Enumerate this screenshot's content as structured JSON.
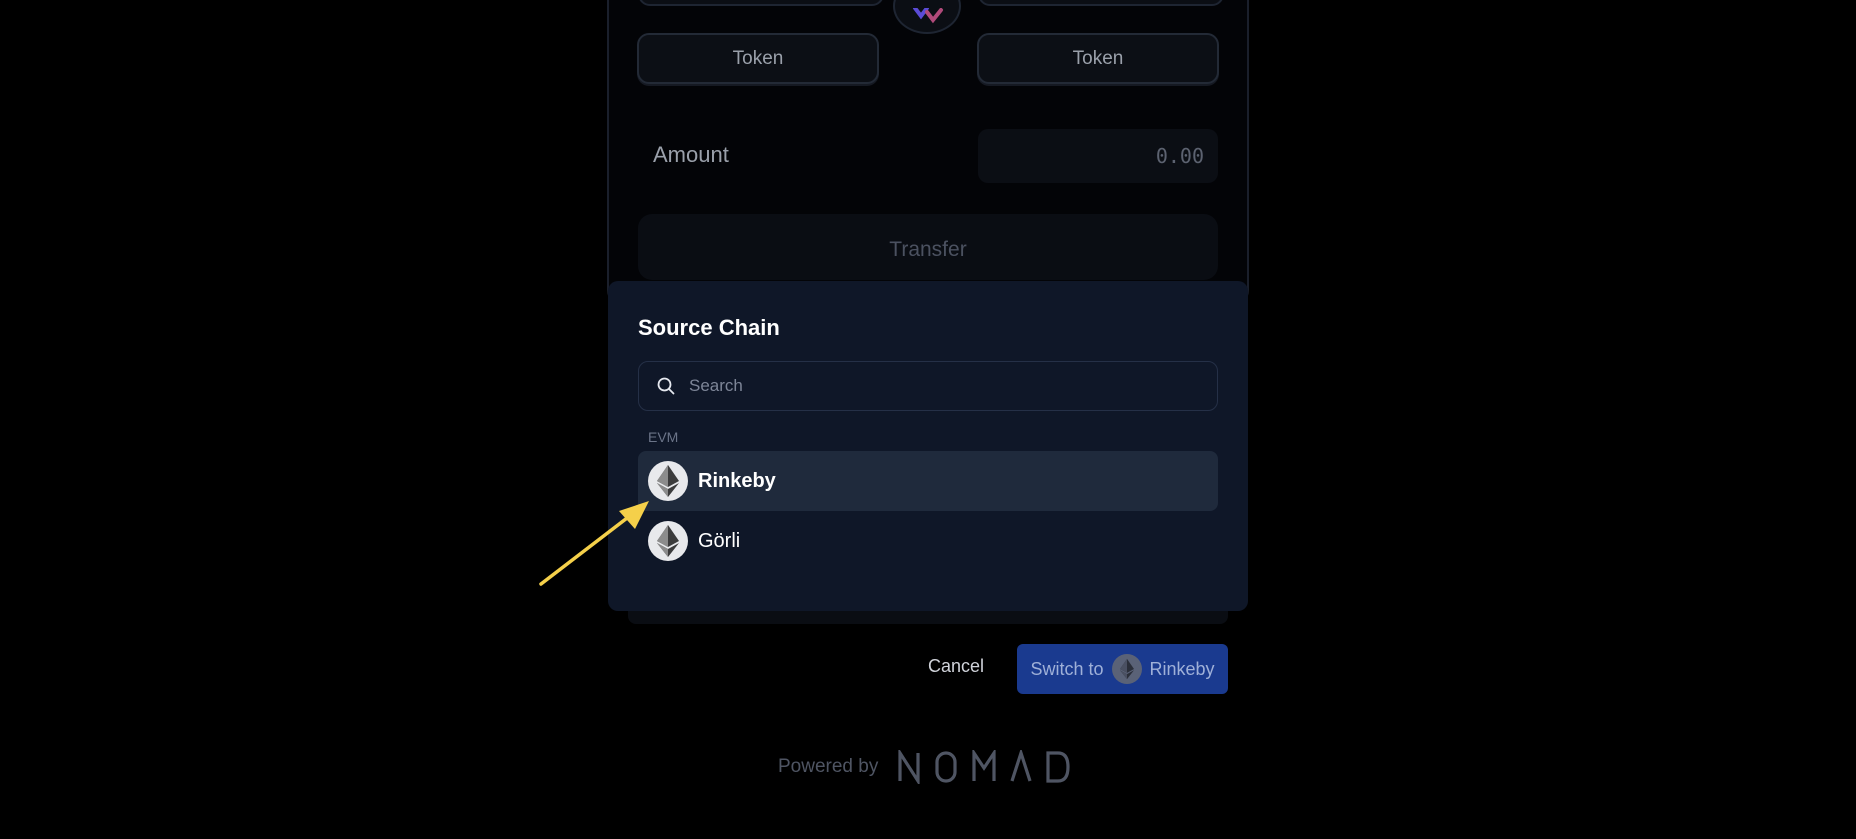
{
  "bridge_form": {
    "from_token_label": "Token",
    "to_token_label": "Token",
    "amount_label": "Amount",
    "amount_value": "0.00",
    "transfer_label": "Transfer"
  },
  "modal": {
    "title": "Source Chain",
    "search_placeholder": "Search",
    "group_label": "EVM",
    "chains": [
      {
        "name": "Rinkeby",
        "icon": "ethereum-icon",
        "highlighted": true
      },
      {
        "name": "Görli",
        "icon": "ethereum-icon",
        "highlighted": false
      }
    ]
  },
  "actions": {
    "cancel_label": "Cancel",
    "switch_prefix": "Switch to",
    "switch_chain": "Rinkeby"
  },
  "footer": {
    "powered_by": "Powered by",
    "brand": "NOMAD"
  },
  "colors": {
    "background": "#000000",
    "modal": "#0f1728",
    "highlight_row": "#1f2a3c",
    "primary_button": "#1a3a8f",
    "annotation_arrow": "#f5d04a"
  }
}
